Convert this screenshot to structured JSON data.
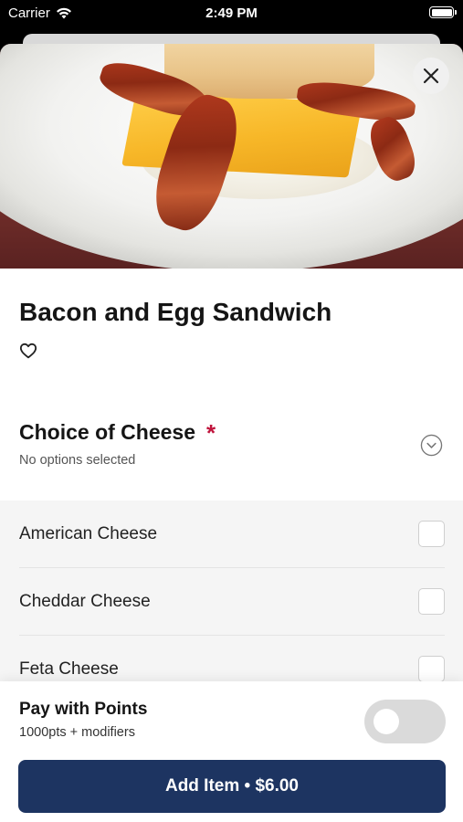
{
  "status_bar": {
    "carrier": "Carrier",
    "time": "2:49 PM"
  },
  "item": {
    "name": "Bacon and Egg Sandwich"
  },
  "modifier_group": {
    "title": "Choice of Cheese",
    "required_mark": "*",
    "status": "No options selected",
    "options": [
      {
        "label": "American Cheese",
        "checked": false
      },
      {
        "label": "Cheddar Cheese",
        "checked": false
      },
      {
        "label": "Feta Cheese",
        "checked": false
      }
    ]
  },
  "footer": {
    "pay_title": "Pay with Points",
    "pay_subtitle": "1000pts + modifiers",
    "pay_toggle_on": false,
    "add_button_label": "Add Item • $6.00"
  },
  "colors": {
    "primary": "#1d3461",
    "required": "#c0143c",
    "option_background": "#f5f5f5"
  },
  "icons": [
    "wifi-icon",
    "battery-icon",
    "close-icon",
    "heart-icon",
    "chevron-down-circle-icon"
  ]
}
